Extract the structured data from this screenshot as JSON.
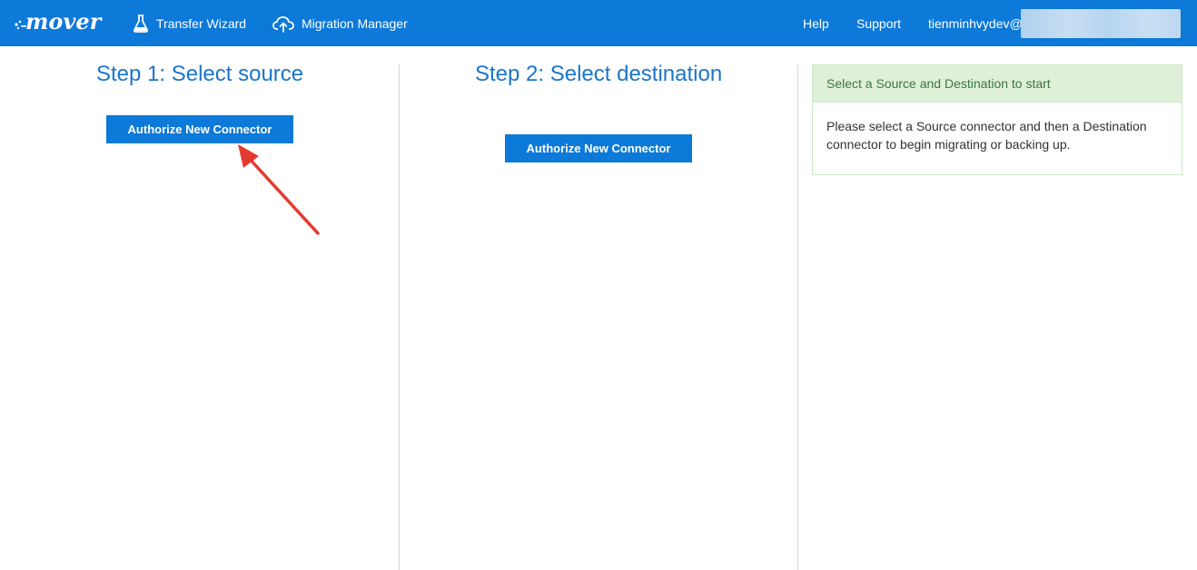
{
  "header": {
    "logo_text": "mover",
    "nav": {
      "transfer_wizard": "Transfer Wizard",
      "migration_manager": "Migration Manager",
      "help": "Help",
      "support": "Support",
      "user": "tienminhvydev@"
    },
    "icons": {
      "transfer_wizard": "flask-icon",
      "migration_manager": "cloud-upload-icon"
    }
  },
  "step1": {
    "title": "Step 1: Select source",
    "button_label": "Authorize New Connector"
  },
  "step2": {
    "title": "Step 2: Select destination",
    "button_label": "Authorize New Connector"
  },
  "info_panel": {
    "heading": "Select a Source and Destination to start",
    "body": "Please select a Source connector and then a Destination connector to begin migrating or backing up."
  },
  "colors": {
    "brand": "#0d79d8",
    "title": "#1a76c9",
    "panel_header_bg": "#dff0d8",
    "panel_header_text": "#3c763d",
    "annotation_arrow": "#e53a2f"
  }
}
